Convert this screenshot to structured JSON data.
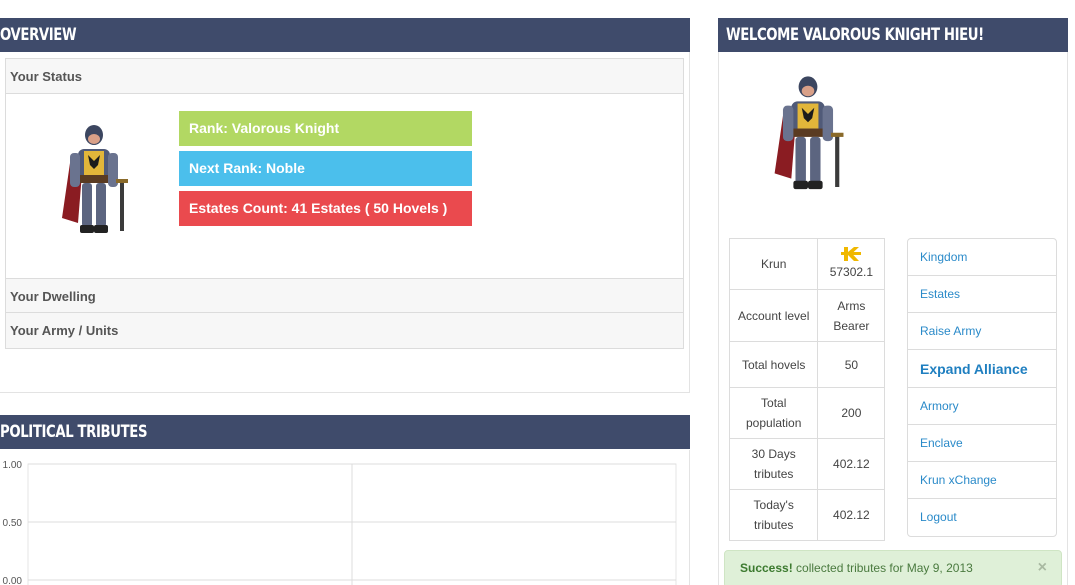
{
  "overview": {
    "title": "OVERVIEW",
    "status_header": "Your Status",
    "rank": "Rank: Valorous Knight",
    "next_rank": "Next Rank: Noble",
    "estates": "Estates Count: 41 Estates ( 50 Hovels )",
    "dwelling_header": "Your Dwelling",
    "army_header": "Your Army / Units"
  },
  "tributes": {
    "title": "POLITICAL TRIBUTES"
  },
  "chart_data": {
    "type": "line",
    "title": "",
    "xlabel": "",
    "ylabel": "",
    "ylim": [
      0,
      1
    ],
    "y_ticks": [
      "1.00",
      "0.50",
      "0.00"
    ],
    "series": [],
    "grid": true
  },
  "welcome": {
    "title": "WELCOME VALOROUS KNIGHT HIEU!"
  },
  "stats": {
    "krun_label": "Krun",
    "krun_value": "57302.1",
    "account_level_label": "Account level",
    "account_level_value": "Arms Bearer",
    "total_hovels_label": "Total hovels",
    "total_hovels_value": "50",
    "total_population_label": "Total population",
    "total_population_value": "200",
    "days30_label": "30 Days tributes",
    "days30_value": "402.12",
    "today_label": "Today's tributes",
    "today_value": "402.12"
  },
  "nav": {
    "kingdom": "Kingdom",
    "estates": "Estates",
    "raise_army": "Raise Army",
    "expand_alliance": "Expand Alliance",
    "armory": "Armory",
    "enclave": "Enclave",
    "krun_xchange": "Krun xChange",
    "logout": "Logout"
  },
  "alert": {
    "strong": "Success!",
    "message": " collected tributes for May 9, 2013",
    "close": "×"
  },
  "colors": {
    "header_bg": "#3f4b6b",
    "rank_green": "#b2d863",
    "next_rank_blue": "#4bbfec",
    "estates_red": "#ea4a4e",
    "link_blue": "#2a8ac9"
  }
}
